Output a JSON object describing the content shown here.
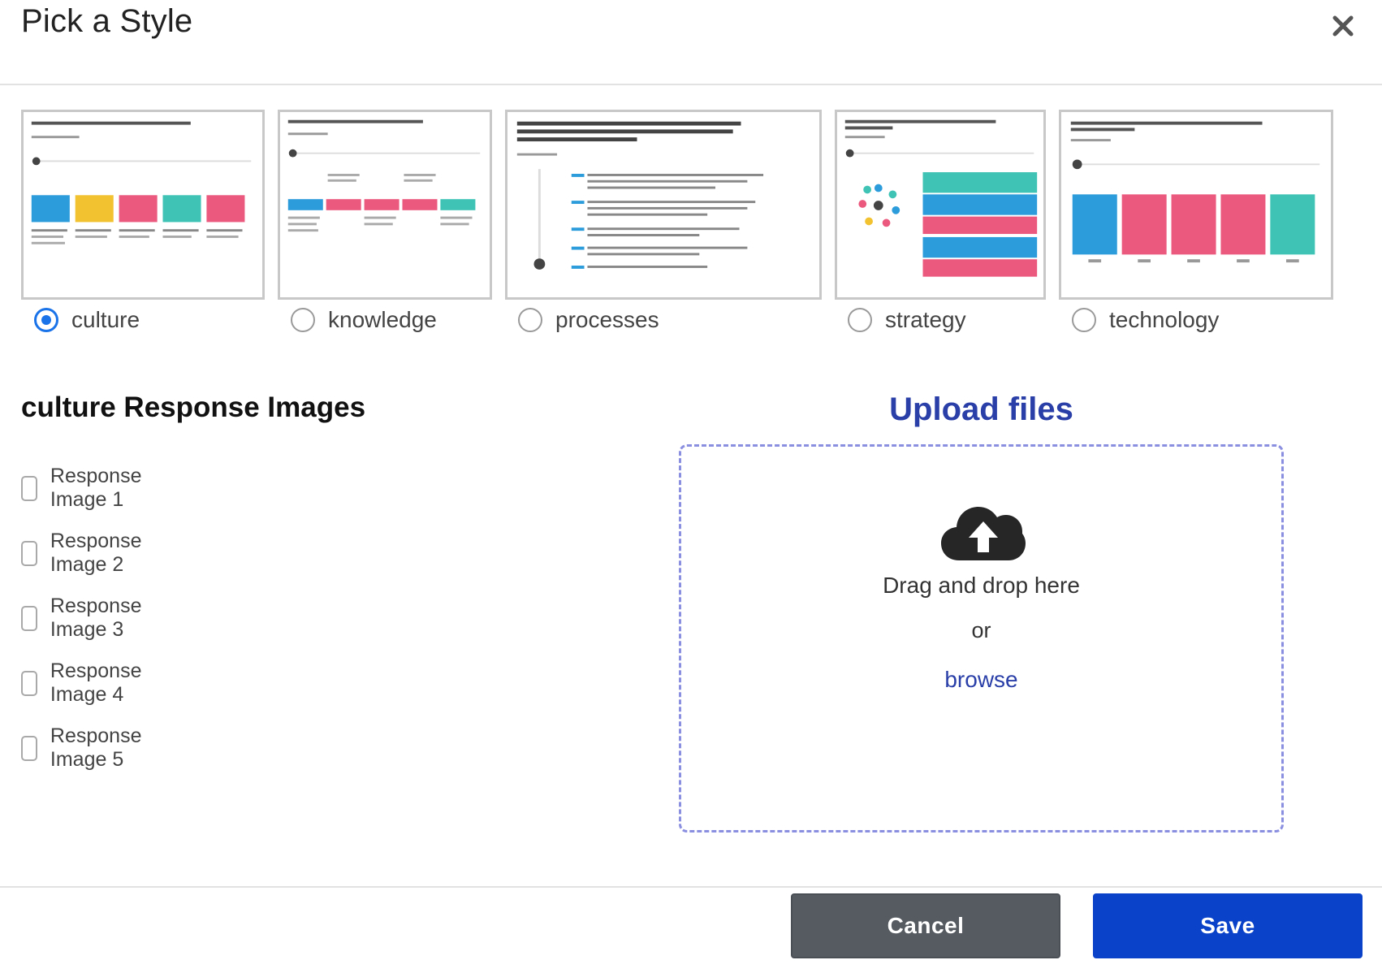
{
  "dialog": {
    "title": "Pick a Style"
  },
  "styles": [
    {
      "label": "culture",
      "selected": true
    },
    {
      "label": "knowledge",
      "selected": false
    },
    {
      "label": "processes",
      "selected": false
    },
    {
      "label": "strategy",
      "selected": false
    },
    {
      "label": "technology",
      "selected": false
    }
  ],
  "response_images": {
    "title": "culture Response Images",
    "items": [
      {
        "label": "Response Image 1",
        "checked": false
      },
      {
        "label": "Response Image 2",
        "checked": false
      },
      {
        "label": "Response Image 3",
        "checked": false
      },
      {
        "label": "Response Image 4",
        "checked": false
      },
      {
        "label": "Response Image 5",
        "checked": false
      }
    ]
  },
  "upload": {
    "title": "Upload files",
    "drag_text": "Drag and drop here",
    "or_text": "or",
    "browse_label": "browse",
    "icon": "cloud-upload-icon"
  },
  "footer": {
    "cancel_label": "Cancel",
    "save_label": "Save"
  },
  "colors": {
    "accent_blue": "#0a43c9",
    "link_blue": "#2a3fa8",
    "radio_blue": "#1a73e8",
    "cancel_gray": "#555b61",
    "dropzone_border": "#8b8fe0"
  }
}
